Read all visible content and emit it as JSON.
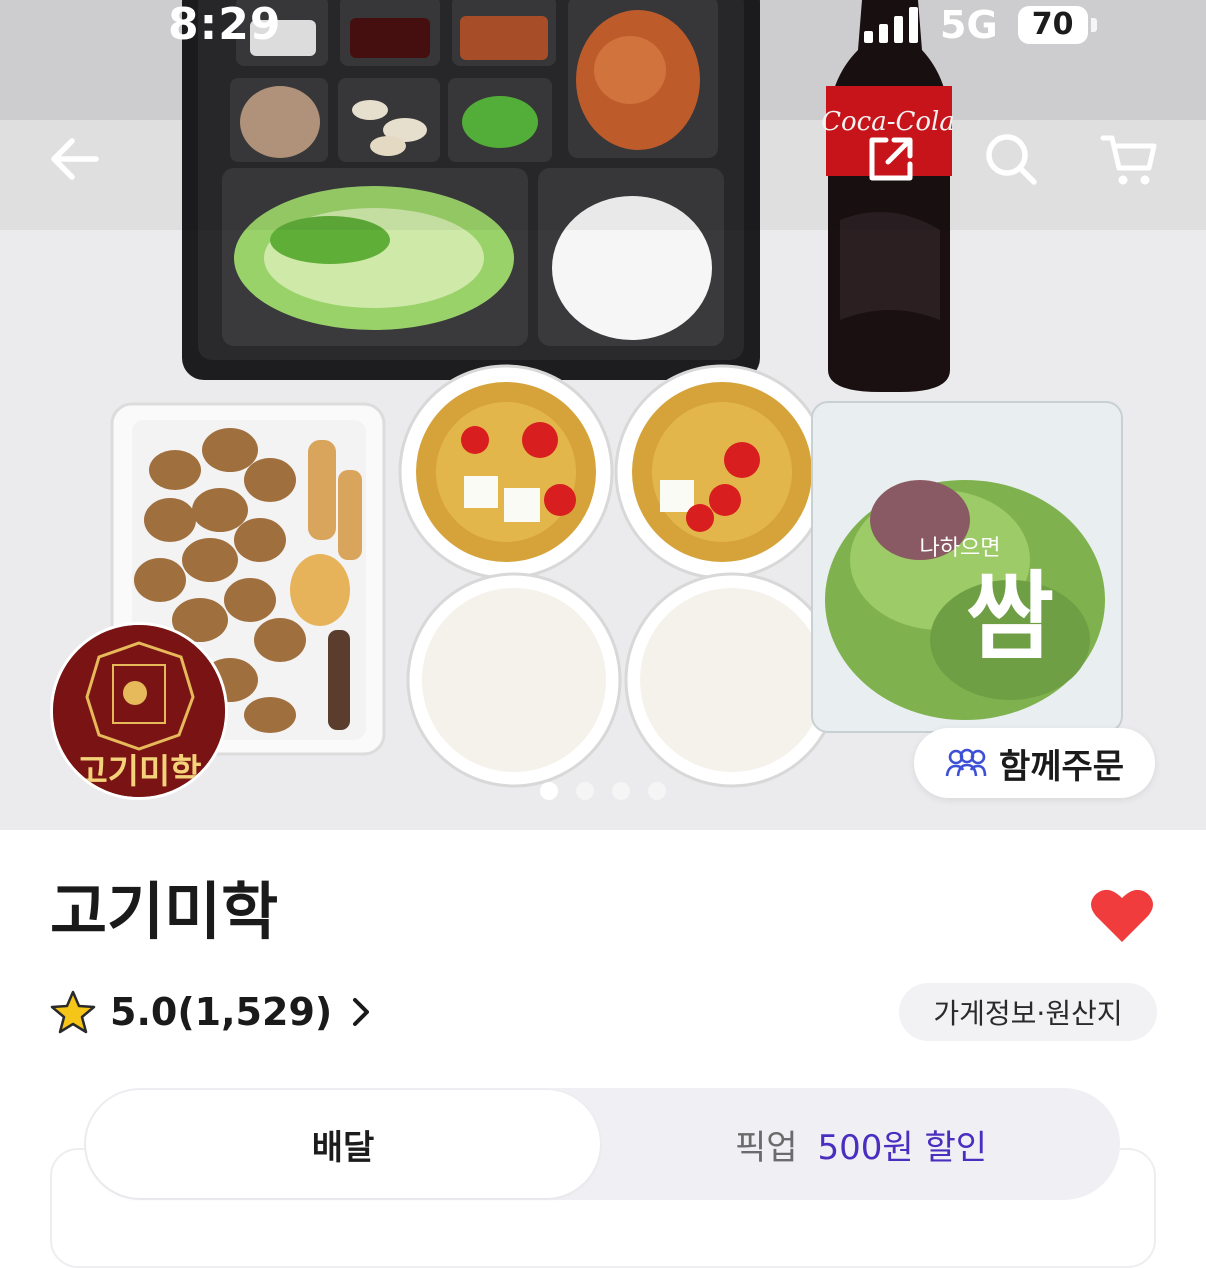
{
  "status_bar": {
    "time": "8:29",
    "network": "5G",
    "battery": "70"
  },
  "hero": {
    "logo_text": "고기미학",
    "lettuce_label": "쌈",
    "lettuce_small": "나하으면",
    "group_order_label": "함께주문",
    "page_count": 4,
    "active_page": 1
  },
  "store": {
    "name": "고기미학",
    "rating": "5.0(1,529)",
    "info_button": "가게정보·원산지",
    "favorited": true
  },
  "tabs": {
    "delivery": "배달",
    "pickup": "픽업",
    "pickup_promo": "500원 할인"
  },
  "colors": {
    "heart": "#f03c3c",
    "promo": "#4a2ec0",
    "star": "#f5c518",
    "logo_bg": "#7a1414"
  },
  "icons": [
    "back-arrow-icon",
    "share-icon",
    "search-icon",
    "cart-icon",
    "heart-icon",
    "star-icon",
    "chevron-right-icon",
    "people-icon"
  ]
}
